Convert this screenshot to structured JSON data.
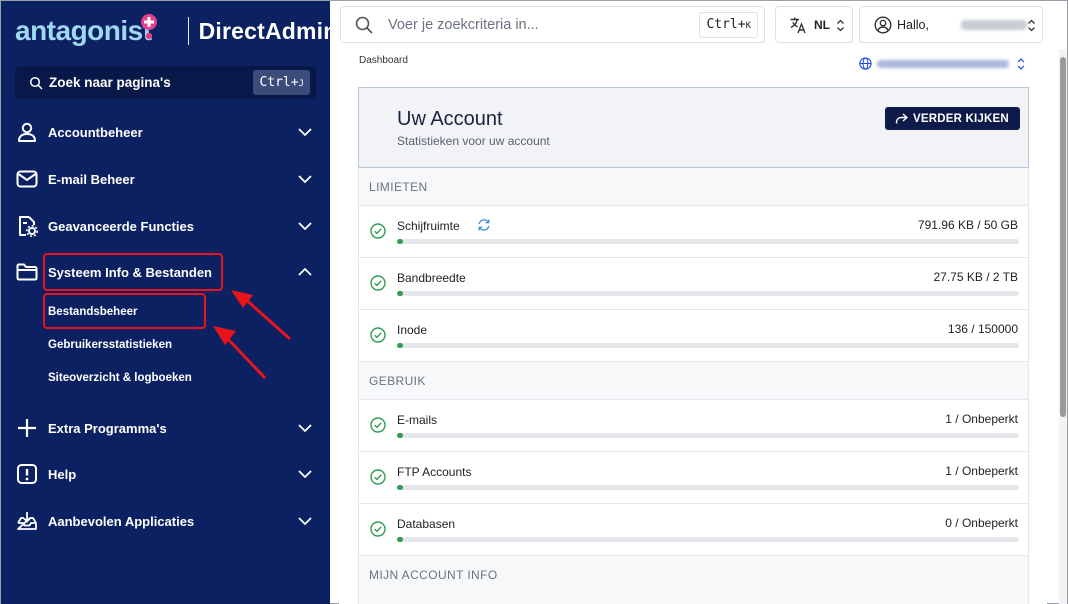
{
  "brand": {
    "logo_text": "antagonist",
    "product": "DirectAdmin"
  },
  "sidebar": {
    "search": {
      "label": "Zoek naar pagina's",
      "kbd": "Ctrl+",
      "kbd_key": "J"
    },
    "items": [
      {
        "label": "Accountbeheer",
        "icon": "user-icon",
        "expanded": false
      },
      {
        "label": "E-mail Beheer",
        "icon": "mail-icon",
        "expanded": false
      },
      {
        "label": "Geavanceerde Functies",
        "icon": "advanced-settings-icon",
        "expanded": false
      },
      {
        "label": "Systeem Info & Bestanden",
        "icon": "folder-icon",
        "expanded": true,
        "children": [
          "Bestandsbeheer",
          "Gebruikersstatistieken",
          "Siteoverzicht & logboeken"
        ]
      },
      {
        "label": "Extra Programma's",
        "icon": "plus-icon",
        "expanded": false
      },
      {
        "label": "Help",
        "icon": "help-icon",
        "expanded": false
      },
      {
        "label": "Aanbevolen Applicaties",
        "icon": "apps-tray-icon",
        "expanded": false
      }
    ]
  },
  "topbar": {
    "search_placeholder": "Voer je zoekcriteria in...",
    "search_kbd": "Ctrl+",
    "search_kbd_key": "K",
    "language": "NL",
    "greeting": "Hallo,"
  },
  "main": {
    "breadcrumb": "Dashboard",
    "account": {
      "title": "Uw Account",
      "subtitle": "Statistieken voor uw account",
      "button": "VERDER KIJKEN"
    },
    "sections": [
      {
        "label": "LIMIETEN",
        "rows": [
          {
            "label": "Schijfruimte",
            "value": "791.96 KB / 50 GB",
            "fraction": 0.01,
            "refresh": true
          },
          {
            "label": "Bandbreedte",
            "value": "27.75 KB / 2 TB",
            "fraction": 0.01
          },
          {
            "label": "Inode",
            "value": "136 / 150000",
            "fraction": 0.01
          }
        ]
      },
      {
        "label": "GEBRUIK",
        "rows": [
          {
            "label": "E-mails",
            "value": "1 / Onbeperkt",
            "fraction": 0.01
          },
          {
            "label": "FTP Accounts",
            "value": "1 / Onbeperkt",
            "fraction": 0.01
          },
          {
            "label": "Databasen",
            "value": "0 / Onbeperkt",
            "fraction": 0.01
          }
        ]
      },
      {
        "label": "MIJN ACCOUNT INFO",
        "rows": []
      }
    ]
  },
  "colors": {
    "sidebar_bg": "#0c2161",
    "accent_pink": "#e63f8e",
    "logo_blue": "#9fd8f0",
    "highlight_red": "#e8141c",
    "ok_green": "#2e9e55",
    "button_navy": "#0d1a4a"
  }
}
